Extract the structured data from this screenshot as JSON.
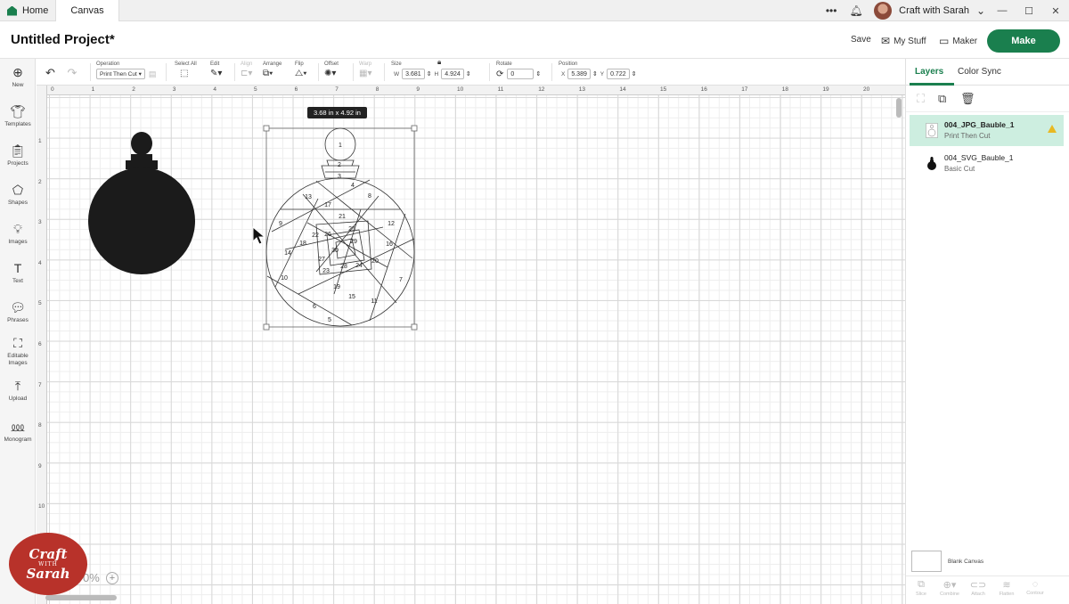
{
  "window": {
    "tabs": [
      {
        "label": "Home"
      },
      {
        "label": "Canvas"
      }
    ],
    "user_name": "Craft with Sarah",
    "icons": {
      "more": "more-dots-icon",
      "bell": "bell-icon",
      "user_menu": "chevron-down-icon",
      "minimize": "minimize-icon",
      "maximize": "maximize-icon",
      "close": "close-icon"
    }
  },
  "header": {
    "project_title": "Untitled Project*",
    "save_label": "Save",
    "mystuff_label": "My Stuff",
    "maker_label": "Maker",
    "make_label": "Make",
    "accent": "#1a7f4e"
  },
  "sidebar": {
    "items": [
      {
        "label": "New",
        "icon": "plus-circle-icon"
      },
      {
        "label": "Templates",
        "icon": "shirt-icon"
      },
      {
        "label": "Projects",
        "icon": "clipboard-icon"
      },
      {
        "label": "Shapes",
        "icon": "shapes-icon"
      },
      {
        "label": "Images",
        "icon": "bulb-icon"
      },
      {
        "label": "Text",
        "icon": "text-icon"
      },
      {
        "label": "Phrases",
        "icon": "speech-bubble-icon"
      },
      {
        "label": "Editable Images",
        "icon": "edit-image-icon"
      },
      {
        "label": "Upload",
        "icon": "upload-icon"
      },
      {
        "label": "Monogram",
        "icon": "monogram-icon"
      }
    ]
  },
  "toolbar": {
    "operation_label": "Operation",
    "operation_value": "Print Then Cut",
    "select_all_label": "Select All",
    "edit_label": "Edit",
    "align_label": "Align",
    "arrange_label": "Arrange",
    "flip_label": "Flip",
    "offset_label": "Offset",
    "warp_label": "Warp",
    "size_label": "Size",
    "size_w_label": "W",
    "size_w": "3.681",
    "size_h_label": "H",
    "size_h": "4.924",
    "rotate_label": "Rotate",
    "rotate_value": "0",
    "position_label": "Position",
    "pos_x_label": "X",
    "pos_x": "5.389",
    "pos_y_label": "Y",
    "pos_y": "0.722"
  },
  "canvas": {
    "ruler_top": [
      "0",
      "1",
      "2",
      "3",
      "4",
      "5",
      "6",
      "7",
      "8",
      "9",
      "10",
      "11",
      "12",
      "13",
      "14",
      "15",
      "16",
      "17",
      "18",
      "19",
      "20"
    ],
    "ruler_left": [
      "1",
      "2",
      "3",
      "4",
      "5",
      "6",
      "7",
      "8",
      "9",
      "10"
    ],
    "size_tag": "3.68  in x 4.92  in",
    "zoom": "100%",
    "zoom_visible": "0%",
    "pattern_numbers": [
      "1",
      "2",
      "3",
      "4",
      "5",
      "6",
      "7",
      "8",
      "9",
      "10",
      "11",
      "12",
      "13",
      "14",
      "15",
      "16",
      "17",
      "18",
      "19",
      "20",
      "21",
      "22",
      "23",
      "24",
      "25",
      "26",
      "27",
      "28",
      "29",
      "30"
    ]
  },
  "panel": {
    "tabs": [
      {
        "label": "Layers"
      },
      {
        "label": "Color Sync"
      }
    ],
    "layers": [
      {
        "name": "004_JPG_Bauble_1",
        "operation": "Print Then Cut",
        "selected": true
      },
      {
        "name": "004_SVG_Bauble_1",
        "operation": "Basic Cut",
        "selected": false
      }
    ],
    "blank_canvas_label": "Blank Canvas",
    "bottom_actions": [
      {
        "label": "Slice"
      },
      {
        "label": "Combine"
      },
      {
        "label": "Attach"
      },
      {
        "label": "Flatten"
      },
      {
        "label": "Contour"
      }
    ]
  },
  "logo": {
    "line1": "Craft",
    "line2": "WITH",
    "line3": "Sarah",
    "color": "#b8322a"
  }
}
